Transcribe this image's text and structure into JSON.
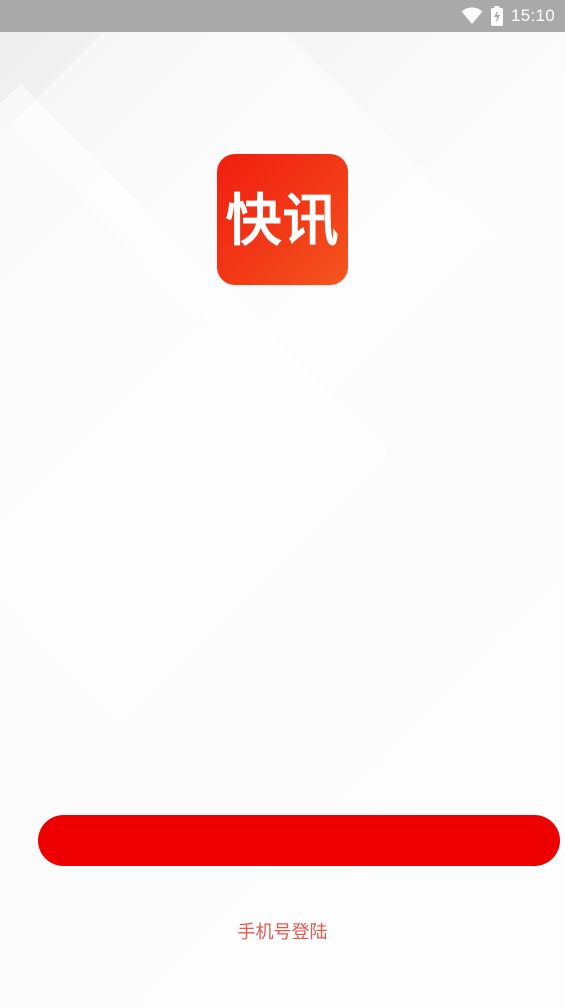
{
  "status_bar": {
    "time": "15:10",
    "wifi_icon": "wifi-icon",
    "battery_icon": "battery-charging-icon"
  },
  "app": {
    "logo_text": "快讯",
    "logo_color": "#f2301a"
  },
  "login": {
    "primary_button_color": "#ee0000",
    "phone_login_label": "手机号登陆",
    "phone_login_color": "#e05a50"
  }
}
